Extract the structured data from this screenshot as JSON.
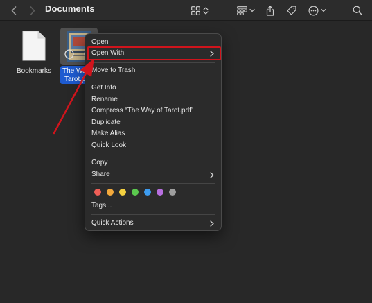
{
  "window": {
    "title": "Documents"
  },
  "toolbar": {
    "icons": [
      "chevron-left-icon",
      "chevron-right-icon",
      "grid-view-icon",
      "sort-icon",
      "group-icon",
      "share-icon",
      "tag-icon",
      "more-icon",
      "search-icon"
    ]
  },
  "files": [
    {
      "name": "Bookmarks"
    },
    {
      "name_line1": "The Way",
      "name_line2": "Tarot.pdf"
    }
  ],
  "context_menu": {
    "items": {
      "open": "Open",
      "open_with": "Open With",
      "move_to_trash": "Move to Trash",
      "get_info": "Get Info",
      "rename": "Rename",
      "compress": "Compress “The Way of Tarot.pdf”",
      "duplicate": "Duplicate",
      "make_alias": "Make Alias",
      "quick_look": "Quick Look",
      "copy": "Copy",
      "share": "Share",
      "tags": "Tags...",
      "quick_actions": "Quick Actions"
    },
    "tag_colors": [
      "#f05f57",
      "#f3a93c",
      "#f4d140",
      "#5bc94e",
      "#3d9cf0",
      "#b86fe0",
      "#9e9e9e"
    ]
  },
  "annotation": {
    "highlight_color": "#d0141c"
  }
}
